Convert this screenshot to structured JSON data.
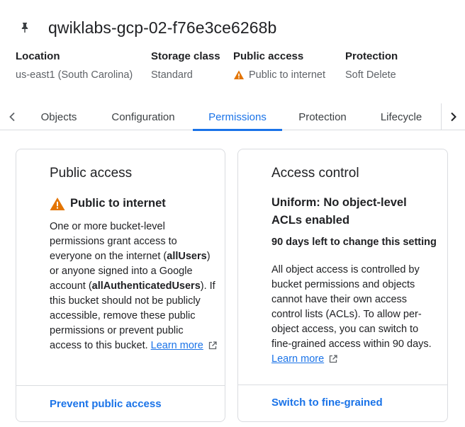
{
  "header": {
    "title": "qwiklabs-gcp-02-f76e3ce6268b",
    "pin_icon": "pin-icon"
  },
  "info": {
    "location_label": "Location",
    "location_value": "us-east1 (South Carolina)",
    "storage_class_label": "Storage class",
    "storage_class_value": "Standard",
    "public_access_label": "Public access",
    "public_access_value": "Public to internet",
    "protection_label": "Protection",
    "protection_value": "Soft Delete"
  },
  "tabs": {
    "items": [
      {
        "label": "Objects"
      },
      {
        "label": "Configuration"
      },
      {
        "label": "Permissions"
      },
      {
        "label": "Protection"
      },
      {
        "label": "Lifecycle"
      }
    ],
    "active": "Permissions"
  },
  "public_access_card": {
    "heading": "Public access",
    "status": "Public to internet",
    "body_1": "One or more bucket-level permissions grant access to everyone on the internet (",
    "all_users": "allUsers",
    "body_2": ") or anyone signed into a Google account (",
    "all_auth_users": "allAuthenticatedUsers",
    "body_3": "). If this bucket should not be publicly accessible, remove these public permissions or prevent public access to this bucket.",
    "learn_more": "Learn more",
    "action": "Prevent public access"
  },
  "access_control_card": {
    "heading": "Access control",
    "subheading": "Uniform: No object-level ACLs enabled",
    "days_left": "90 days left to change this setting",
    "body": "All object access is controlled by bucket permissions and objects cannot have their own access control lists (ACLs). To allow per-object access, you can switch to fine-grained access within 90 days.",
    "learn_more": "Learn more",
    "action": "Switch to fine-grained"
  },
  "colors": {
    "accent": "#1a73e8",
    "warning": "#e37400",
    "border": "#dadce0",
    "secondary_text": "#5f6368"
  }
}
